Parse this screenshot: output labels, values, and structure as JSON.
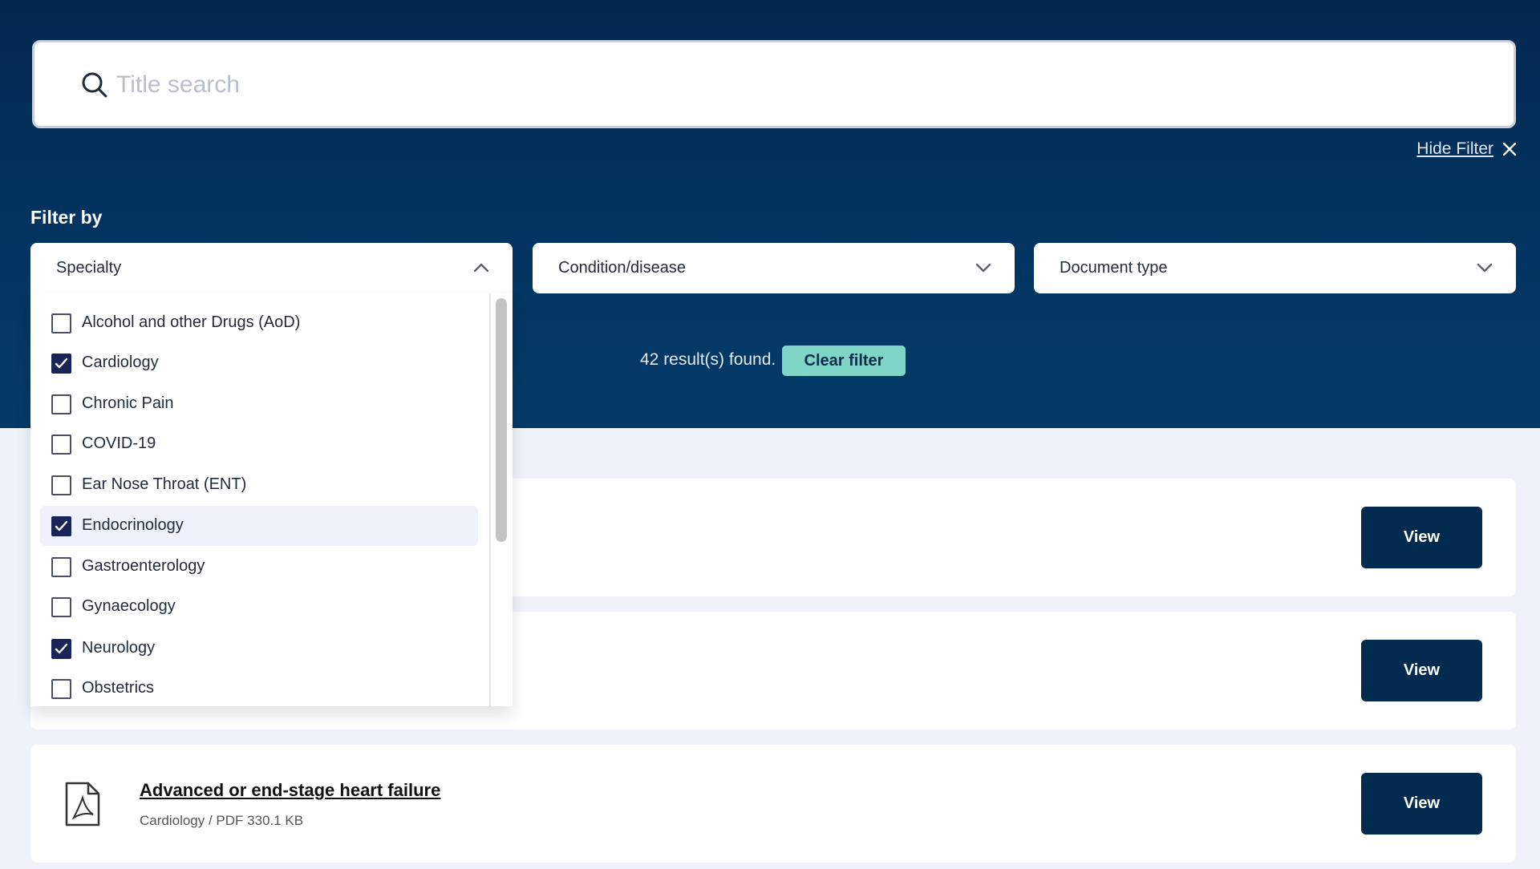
{
  "search": {
    "placeholder": "Title search"
  },
  "filter": {
    "hide_label": "Hide Filter",
    "heading": "Filter by",
    "dropdowns": {
      "specialty": "Specialty",
      "condition": "Condition/disease",
      "doctype": "Document type"
    },
    "specialty_options": [
      {
        "label": "Alcohol and other Drugs (AoD)",
        "checked": false
      },
      {
        "label": "Cardiology",
        "checked": true
      },
      {
        "label": "Chronic Pain",
        "checked": false
      },
      {
        "label": "COVID-19",
        "checked": false
      },
      {
        "label": "Ear Nose Throat (ENT)",
        "checked": false
      },
      {
        "label": "Endocrinology",
        "checked": true
      },
      {
        "label": "Gastroenterology",
        "checked": false
      },
      {
        "label": "Gynaecology",
        "checked": false
      },
      {
        "label": "Neurology",
        "checked": true
      },
      {
        "label": "Obstetrics",
        "checked": false
      }
    ],
    "results_text": "42 result(s) found.",
    "clear_label": "Clear filter"
  },
  "results": [
    {
      "title": "",
      "meta": "",
      "view_label": "View"
    },
    {
      "title": "",
      "meta": "",
      "view_label": "View"
    },
    {
      "title": "Advanced or end-stage heart failure",
      "meta": "Cardiology / PDF 330.1 KB",
      "view_label": "View"
    }
  ],
  "colors": {
    "hero": "#03284f",
    "button": "#032a4f",
    "accent": "#7fd6c6",
    "checkbox": "#1a2557"
  }
}
